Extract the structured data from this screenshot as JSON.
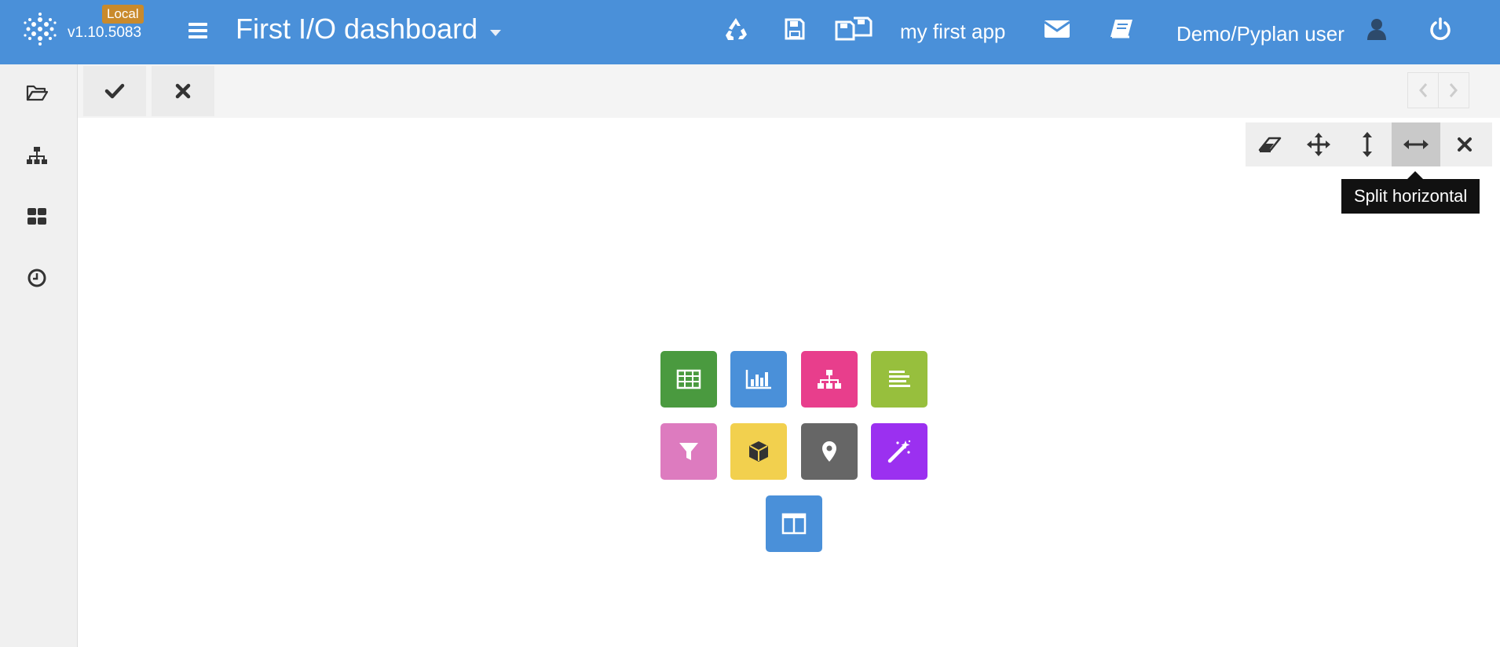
{
  "header": {
    "version": "v1.10.5083",
    "env_badge": "Local",
    "dashboard_title": "First I/O dashboard",
    "app_name": "my first app",
    "user_name": "Demo/Pyplan user",
    "icons": [
      "logo-icon",
      "menu-icon",
      "recycle-icon",
      "save-icon",
      "save-as-icon",
      "envelope-icon",
      "book-icon",
      "user-icon",
      "power-icon"
    ]
  },
  "sidebar": {
    "items": [
      "folder-open-icon",
      "sitemap-icon",
      "dashboard-icon",
      "clock-icon"
    ]
  },
  "actionbar": {
    "confirm_icon": "check-icon",
    "cancel_icon": "close-icon",
    "prev_icon": "chevron-left-icon",
    "next_icon": "chevron-right-icon"
  },
  "layout_tools": {
    "items": [
      "eraser-icon",
      "move-icon",
      "split-vertical-icon",
      "split-horizontal-icon",
      "close-icon"
    ],
    "active": "split-horizontal-icon",
    "tooltip": "Split horizontal"
  },
  "component_tiles": [
    {
      "name": "table-icon",
      "color": "#4a9a3f"
    },
    {
      "name": "bar-chart-icon",
      "color": "#4a90d9"
    },
    {
      "name": "diagram-icon",
      "color": "#e83e8c"
    },
    {
      "name": "text-icon",
      "color": "#97bf3d"
    },
    {
      "name": "filter-icon",
      "color": "#dd7bbf"
    },
    {
      "name": "cube-icon",
      "color": "#f2d04e"
    },
    {
      "name": "map-marker-icon",
      "color": "#666666"
    },
    {
      "name": "magic-wand-icon",
      "color": "#9b30f0"
    },
    {
      "name": "layout-split-icon",
      "color": "#4a90d9"
    }
  ],
  "colors": {
    "header": "#4a90d9",
    "badge": "#c98a2c"
  }
}
